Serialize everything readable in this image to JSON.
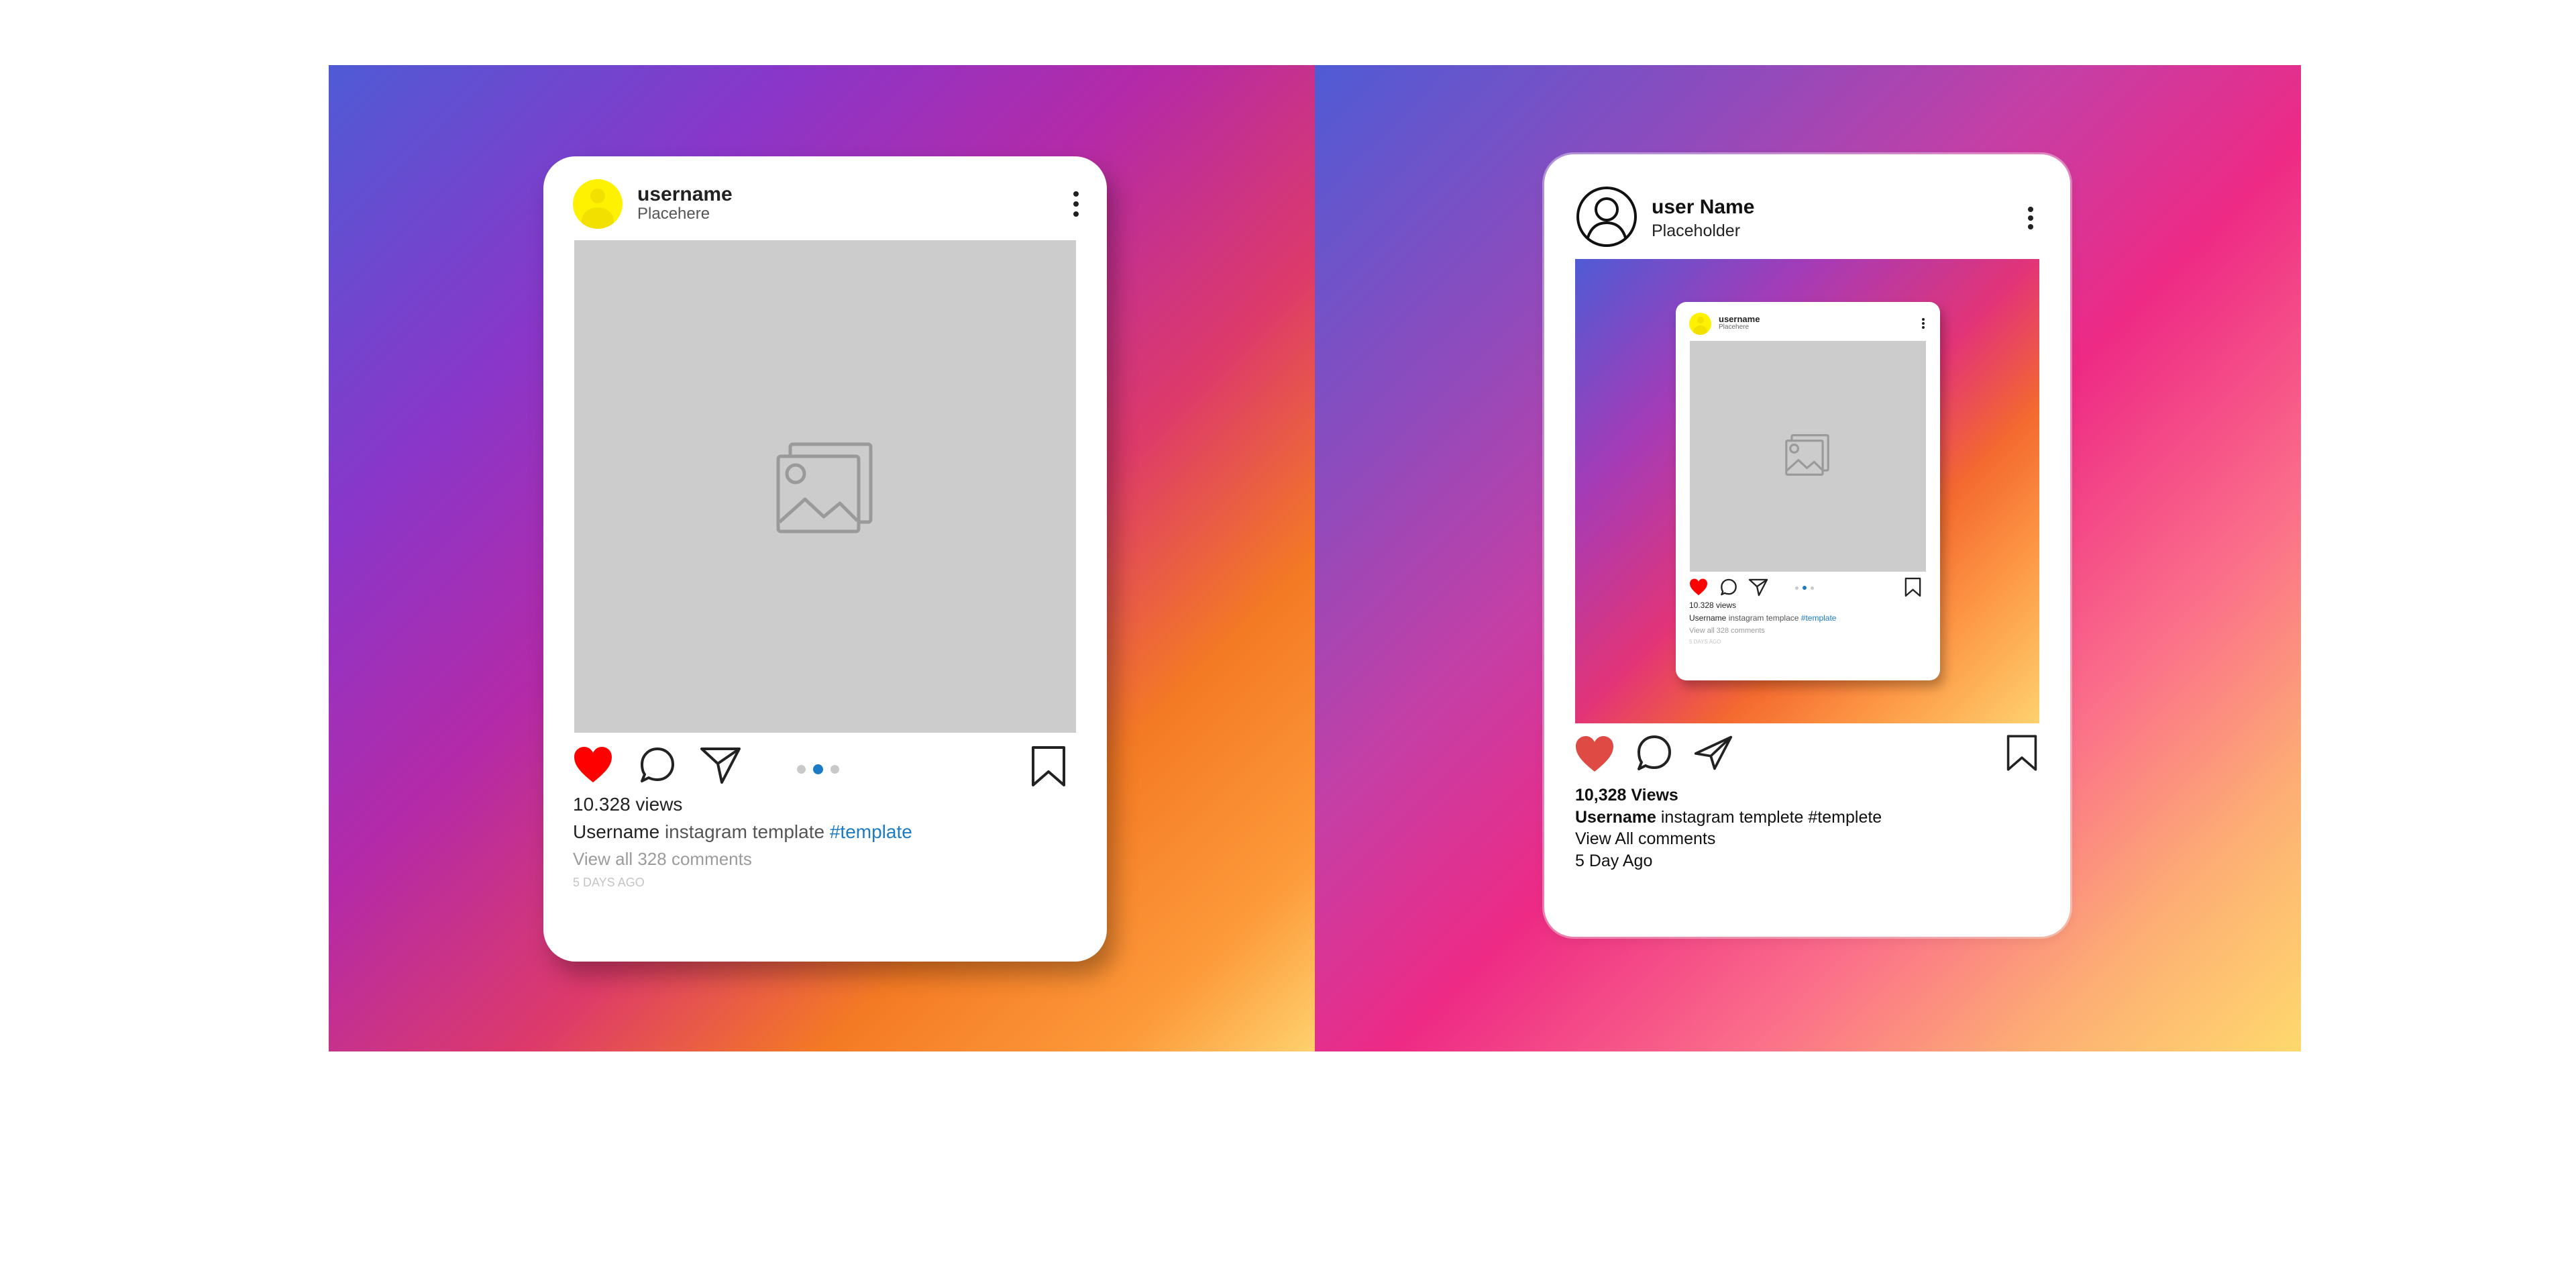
{
  "left_post": {
    "username": "username",
    "subtitle": "Placehere",
    "views": "10.328 views",
    "caption_user": "Username",
    "caption_text": "instagram template",
    "caption_tag": "#template",
    "comments_link": "View all 328 comments",
    "time_ago": "5 DAYS AGO",
    "liked": true,
    "active_dot": 2,
    "dot_count": 3
  },
  "right_post": {
    "username": "user Name",
    "subtitle": "Placeholder",
    "views": "10,328 Views",
    "caption_user": "Username",
    "caption_text": "instagram templete #templete",
    "comments_link": "View All comments",
    "time_ago": "5 Day Ago",
    "liked": true
  },
  "nested_post": {
    "username": "username",
    "subtitle": "Placehere",
    "views": "10.328 views",
    "caption_user": "Username",
    "caption_text": "instagram templace",
    "caption_tag": "#template",
    "comments_link": "View all 328 comments",
    "time_ago": "5 DAYS AGO"
  },
  "colors": {
    "heart": "#ff0000",
    "heart_right": "#e04a44",
    "tag_blue": "#1b7bc4",
    "active_dot": "#1b7bc4",
    "inactive_dot": "#c9c9c9",
    "avatar_yellow": "#fff200",
    "image_placeholder": "#cccccc"
  }
}
